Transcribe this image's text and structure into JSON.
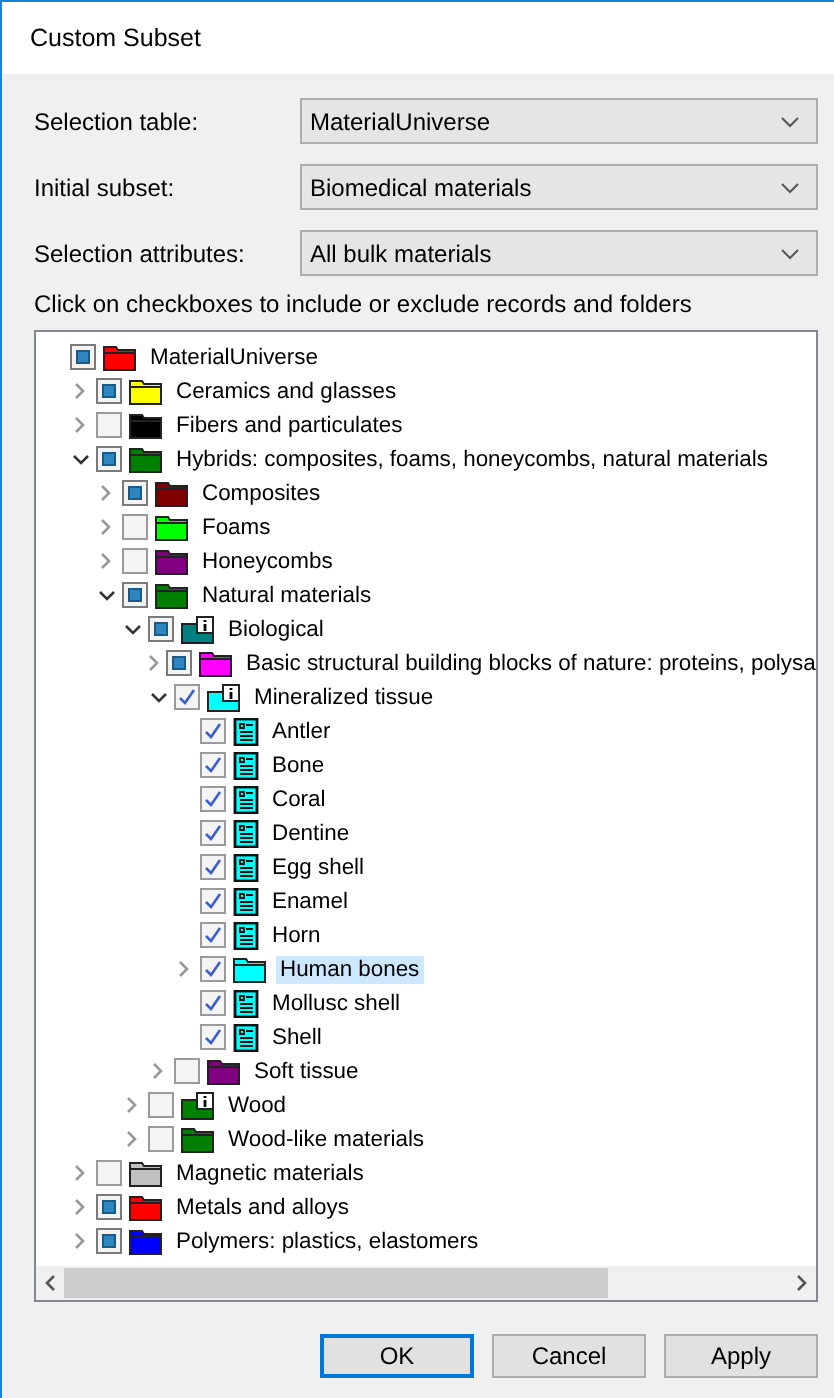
{
  "window": {
    "title": "Custom Subset"
  },
  "fields": [
    {
      "label": "Selection table:",
      "value": "MaterialUniverse"
    },
    {
      "label": "Initial subset:",
      "value": "Biomedical materials"
    },
    {
      "label": "Selection attributes:",
      "value": "All bulk materials"
    }
  ],
  "instruction": "Click on checkboxes to include or exclude records and folders",
  "tree": {
    "items": [
      {
        "label": "MaterialUniverse",
        "kind": "folder",
        "color": "#ff0000",
        "checked": false,
        "partial": true,
        "selected": false,
        "children": [
          {
            "label": "Ceramics and glasses",
            "kind": "folder",
            "color": "#ffff00",
            "checked": false,
            "partial": true,
            "expanded": false,
            "selected": false
          },
          {
            "label": "Fibers and particulates",
            "kind": "folder",
            "color": "#000000",
            "checked": false,
            "partial": false,
            "expanded": false,
            "selected": false
          },
          {
            "label": "Hybrids: composites, foams, honeycombs, natural materials",
            "kind": "folder",
            "color": "#008000",
            "checked": false,
            "partial": true,
            "expanded": true,
            "selected": false,
            "children": [
              {
                "label": "Composites",
                "kind": "folder",
                "color": "#800000",
                "checked": false,
                "partial": true,
                "expanded": false,
                "selected": false
              },
              {
                "label": "Foams",
                "kind": "folder",
                "color": "#00ff00",
                "checked": false,
                "partial": false,
                "expanded": false,
                "selected": false
              },
              {
                "label": "Honeycombs",
                "kind": "folder",
                "color": "#800080",
                "checked": false,
                "partial": false,
                "expanded": false,
                "selected": false
              },
              {
                "label": "Natural materials",
                "kind": "folder",
                "color": "#008000",
                "checked": false,
                "partial": true,
                "expanded": true,
                "selected": false,
                "children": [
                  {
                    "label": "Biological",
                    "kind": "info-folder",
                    "color": "#008080",
                    "checked": false,
                    "partial": true,
                    "expanded": true,
                    "selected": false,
                    "children": [
                      {
                        "label": "Basic structural building blocks of nature: proteins, polysa",
                        "kind": "folder",
                        "color": "#ff00ff",
                        "checked": false,
                        "partial": true,
                        "expanded": false,
                        "selected": false
                      },
                      {
                        "label": "Mineralized tissue",
                        "kind": "info-folder",
                        "color": "#00ffff",
                        "checked": true,
                        "partial": false,
                        "expanded": true,
                        "selected": false,
                        "children": [
                          {
                            "label": "Antler",
                            "kind": "record",
                            "checked": true,
                            "partial": false,
                            "selected": false
                          },
                          {
                            "label": "Bone",
                            "kind": "record",
                            "checked": true,
                            "partial": false,
                            "selected": false
                          },
                          {
                            "label": "Coral",
                            "kind": "record",
                            "checked": true,
                            "partial": false,
                            "selected": false
                          },
                          {
                            "label": "Dentine",
                            "kind": "record",
                            "checked": true,
                            "partial": false,
                            "selected": false
                          },
                          {
                            "label": "Egg shell",
                            "kind": "record",
                            "checked": true,
                            "partial": false,
                            "selected": false
                          },
                          {
                            "label": "Enamel",
                            "kind": "record",
                            "checked": true,
                            "partial": false,
                            "selected": false
                          },
                          {
                            "label": "Horn",
                            "kind": "record",
                            "checked": true,
                            "partial": false,
                            "selected": false
                          },
                          {
                            "label": "Human bones",
                            "kind": "folder",
                            "color": "#00ffff",
                            "checked": true,
                            "partial": false,
                            "expanded": false,
                            "selected": true
                          },
                          {
                            "label": "Mollusc shell",
                            "kind": "record",
                            "checked": true,
                            "partial": false,
                            "selected": false
                          },
                          {
                            "label": "Shell",
                            "kind": "record",
                            "checked": true,
                            "partial": false,
                            "selected": false
                          }
                        ]
                      },
                      {
                        "label": "Soft tissue",
                        "kind": "folder",
                        "color": "#800080",
                        "checked": false,
                        "partial": false,
                        "expanded": false,
                        "selected": false
                      }
                    ]
                  },
                  {
                    "label": "Wood",
                    "kind": "info-folder",
                    "color": "#008000",
                    "checked": false,
                    "partial": false,
                    "expanded": false,
                    "selected": false
                  },
                  {
                    "label": "Wood-like materials",
                    "kind": "folder",
                    "color": "#008000",
                    "checked": false,
                    "partial": false,
                    "expanded": false,
                    "selected": false
                  }
                ]
              }
            ]
          },
          {
            "label": "Magnetic materials",
            "kind": "folder",
            "color": "#c0c0c0",
            "checked": false,
            "partial": false,
            "expanded": false,
            "selected": false
          },
          {
            "label": "Metals and alloys",
            "kind": "folder",
            "color": "#ff0000",
            "checked": false,
            "partial": true,
            "expanded": false,
            "selected": false
          },
          {
            "label": "Polymers: plastics, elastomers",
            "kind": "folder",
            "color": "#0000ff",
            "checked": false,
            "partial": true,
            "expanded": false,
            "selected": false
          }
        ]
      }
    ]
  },
  "buttons": [
    {
      "label": "OK",
      "default": true
    },
    {
      "label": "Cancel",
      "default": false
    },
    {
      "label": "Apply",
      "default": false
    }
  ]
}
